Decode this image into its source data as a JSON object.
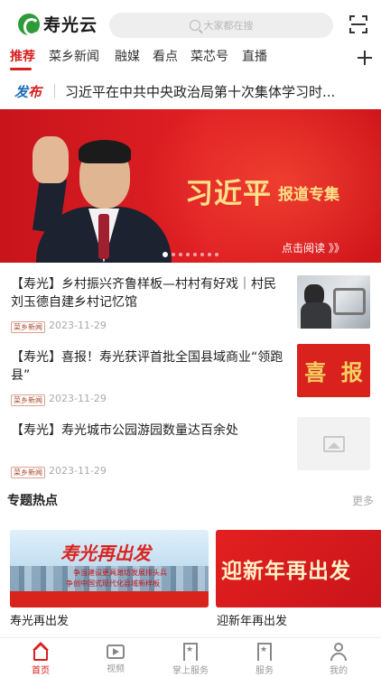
{
  "app": {
    "name": "寿光云",
    "search_placeholder": "大家都在搜"
  },
  "tabs": [
    "推荐",
    "菜乡新闻",
    "融媒",
    "看点",
    "菜芯号",
    "直播"
  ],
  "ticker": {
    "badge_1": "发",
    "badge_2": "布",
    "text": "习近平在中共中央政治局第十次集体学习时..."
  },
  "banner": {
    "title": "习近平",
    "subtitle": "报道专集",
    "read_more": "点击阅读 》》",
    "slide_count": 8,
    "active_slide": 1
  },
  "news": [
    {
      "title": "【寿光】乡村振兴齐鲁样板—村村有好戏｜村民刘玉德自建乡村记忆馆",
      "tag": "菜乡新闻",
      "date": "2023-11-29",
      "image": "person-with-machine"
    },
    {
      "title": "【寿光】喜报！寿光获评首批全国县域商业“领跑县”",
      "tag": "菜乡新闻",
      "date": "2023-11-29",
      "image": "xibao",
      "image_text": [
        "喜",
        "报"
      ]
    },
    {
      "title": "【寿光】寿光城市公园游园数量达百余处",
      "tag": "菜乡新闻",
      "date": "2023-11-29",
      "image": "placeholder"
    }
  ],
  "topics": {
    "title": "专题热点",
    "more": "更多",
    "items": [
      {
        "caption": "寿光再出发",
        "image_title": "寿光再出发",
        "image_line_1": "争当建设更具潍坊发展排头兵",
        "image_line_2": "争创中国式现代化县域新样板"
      },
      {
        "caption": "迎新年再出发",
        "image_title": "迎新年再出发"
      }
    ]
  },
  "bottom_nav": [
    {
      "label": "首页",
      "icon": "home-icon",
      "active": true
    },
    {
      "label": "视频",
      "icon": "video-icon",
      "active": false
    },
    {
      "label": "掌上服务",
      "icon": "bookmark-icon",
      "active": false
    },
    {
      "label": "服务",
      "icon": "bookmark-icon",
      "active": false
    },
    {
      "label": "我的",
      "icon": "user-icon",
      "active": false
    }
  ],
  "colors": {
    "accent": "#d81e1e",
    "brand_green": "#2e9b3a",
    "badge_blue": "#1c6ab8"
  }
}
